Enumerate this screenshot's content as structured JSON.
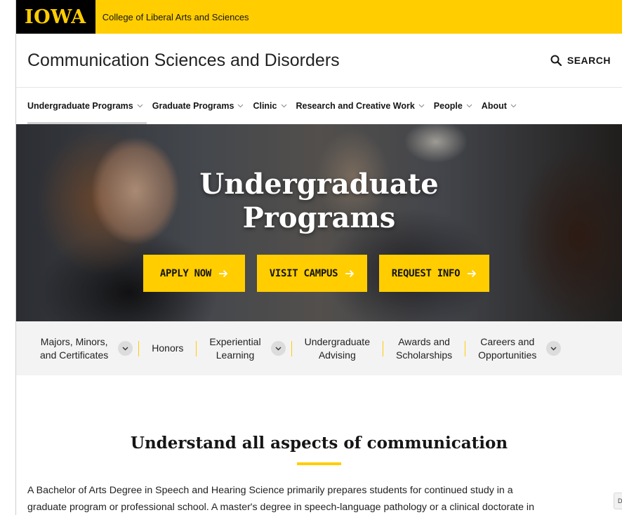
{
  "topbar": {
    "logo": "IOWA",
    "college": "College of Liberal Arts and Sciences"
  },
  "header": {
    "title": "Communication Sciences and Disorders",
    "search_label": "SEARCH"
  },
  "nav": {
    "items": [
      {
        "label": "Undergraduate Programs"
      },
      {
        "label": "Graduate Programs"
      },
      {
        "label": "Clinic"
      },
      {
        "label": "Research and Creative Work"
      },
      {
        "label": "People"
      },
      {
        "label": "About"
      }
    ]
  },
  "hero": {
    "title_line1": "Undergraduate",
    "title_line2": "Programs",
    "buttons": [
      {
        "label": "APPLY NOW"
      },
      {
        "label": "VISIT CAMPUS"
      },
      {
        "label": "REQUEST INFO"
      }
    ]
  },
  "subnav": {
    "items": [
      {
        "line1": "Majors, Minors,",
        "line2": "and Certificates"
      },
      {
        "line1": "Honors"
      },
      {
        "line1": "Experiential",
        "line2": "Learning"
      },
      {
        "line1": "Undergraduate",
        "line2": "Advising"
      },
      {
        "line1": "Awards and",
        "line2": "Scholarships"
      },
      {
        "line1": "Careers and",
        "line2": "Opportunities"
      }
    ]
  },
  "content": {
    "heading": "Understand all aspects of communication",
    "paragraph_line1": "A Bachelor of Arts Degree in Speech and Hearing Science primarily prepares students for continued study in a",
    "paragraph_line2": "graduate program or professional school. A master's degree in speech-language pathology or a clinical doctorate in"
  },
  "corner_widget": {
    "label": "D"
  },
  "colors": {
    "brand_gold": "#FFCD00",
    "black": "#000000",
    "subnav_bg": "#f3f3f3"
  }
}
